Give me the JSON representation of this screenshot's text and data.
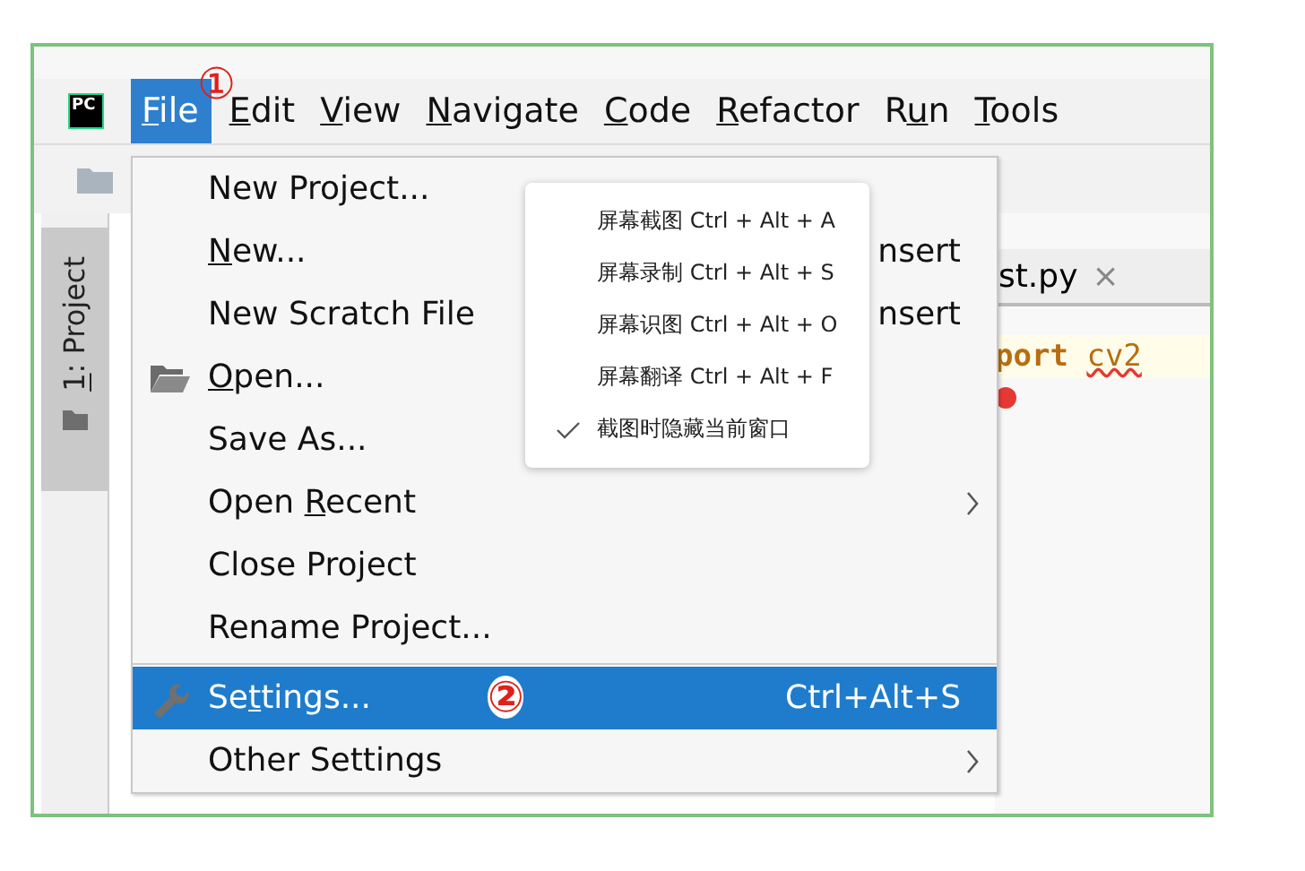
{
  "window": {
    "logo": "PC"
  },
  "menu_bar": [
    {
      "key": "F",
      "after": "ile",
      "selected": true,
      "annotation": "①"
    },
    {
      "key": "E",
      "after": "dit",
      "selected": false
    },
    {
      "key": "V",
      "after": "iew",
      "selected": false
    },
    {
      "key": "N",
      "after": "avigate",
      "selected": false
    },
    {
      "key": "C",
      "after": "ode",
      "selected": false
    },
    {
      "key": "R",
      "after": "efactor",
      "selected": false
    },
    {
      "before": "R",
      "key": "u",
      "after": "n",
      "selected": false
    },
    {
      "key": "T",
      "after": "ools",
      "selected": false
    }
  ],
  "tool_window_tab": {
    "key": "1",
    "after": ": Project",
    "selected": true
  },
  "editor": {
    "tab": {
      "label": "st.py",
      "close": "×"
    },
    "code": [
      {
        "keyword": "port",
        "name": "cv2",
        "misspelled": true
      }
    ]
  },
  "file_menu": [
    {
      "kind": "plain",
      "before": "New Project...",
      "selected": false
    },
    {
      "kind": "plain",
      "key": "N",
      "after": "ew...",
      "shortcut": "nsert",
      "selected": false
    },
    {
      "kind": "plain",
      "before": "New Scratch File",
      "shortcut": "nsert",
      "selected": false
    },
    {
      "kind": "folder",
      "key": "O",
      "after": "pen...",
      "selected": false
    },
    {
      "kind": "plain",
      "before": "Save As...",
      "selected": false
    },
    {
      "kind": "submenu",
      "before": "Open ",
      "key": "R",
      "after": "ecent",
      "selected": false
    },
    {
      "kind": "plain",
      "before": "Close Project",
      "selected": false
    },
    {
      "kind": "plain",
      "before": "Rename Project...",
      "selected": false
    },
    {
      "kind": "wrench",
      "before": "Se",
      "key": "t",
      "after": "tings...",
      "shortcut": "Ctrl+Alt+S",
      "selected": true,
      "separator_before": true,
      "annotation": "②"
    },
    {
      "kind": "submenu",
      "before": "Other Settings",
      "selected": false
    }
  ],
  "popup": [
    {
      "label": "屏幕截图 Ctrl + Alt + A",
      "checked": false
    },
    {
      "label": "屏幕录制 Ctrl + Alt + S",
      "checked": false
    },
    {
      "label": "屏幕识图 Ctrl + Alt + O",
      "checked": false
    },
    {
      "label": "屏幕翻译 Ctrl + Alt + F",
      "checked": false
    },
    {
      "label": "截图时隐藏当前窗口",
      "checked": true
    }
  ]
}
